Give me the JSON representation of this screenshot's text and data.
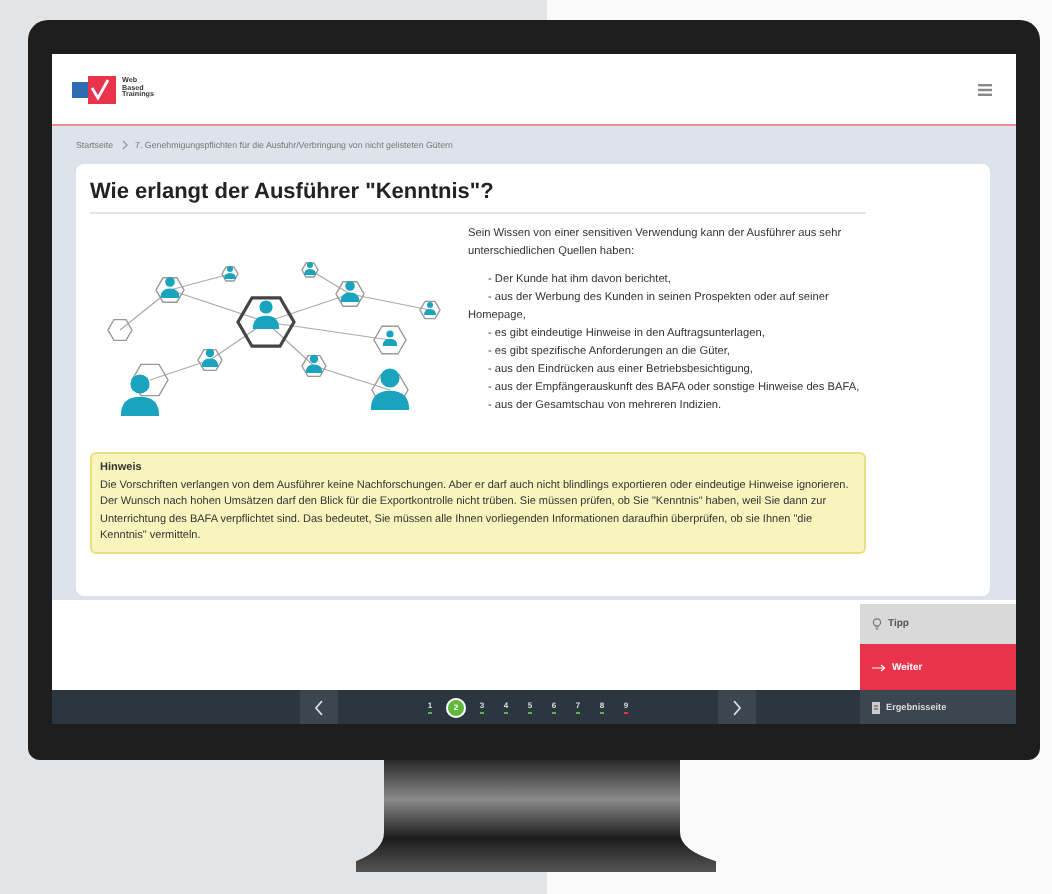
{
  "header": {
    "logo_lines": [
      "Web",
      "Based",
      "Trainings"
    ]
  },
  "breadcrumb": [
    "Startseite",
    "7. Genehmigungspflichten für die Ausfuhr/Verbringung von nicht gelisteten Gütern"
  ],
  "content": {
    "title": "Wie erlangt der Ausführer \"Kenntnis\"?",
    "intro": "Sein Wissen von einer sensitiven Verwendung kann der Ausführer aus sehr unterschiedlichen Quellen haben:",
    "bullets": [
      "- Der Kunde hat ihm davon berichtet,",
      "- aus der Werbung des Kunden in seinen Prospekten oder auf seiner Homepage,",
      "- es gibt eindeutige Hinweise in den Auftragsunterlagen,",
      "- es gibt spezifische Anforderungen an die Güter,",
      "- aus den Eindrücken aus einer Betriebsbesichtigung,",
      "- aus der Empfängerauskunft des BAFA oder sonstige Hinweise des BAFA,",
      "- aus der Gesamtschau von mehreren Indizien."
    ],
    "note": {
      "title": "Hinweis",
      "text": "Die Vorschriften verlangen von dem Ausführer keine Nachforschungen. Aber er darf auch nicht blindlings exportieren oder eindeutige Hinweise ignorieren. Der Wunsch nach hohen Umsätzen darf den Blick für die Exportkontrolle nicht trüben. Sie müssen prüfen, ob Sie \"Kenntnis\" haben, weil Sie dann zur Unterrichtung des BAFA verpflichtet sind. Das bedeutet, Sie müssen alle Ihnen vorliegenden Informationen daraufhin überprüfen, ob sie Ihnen \"die Kenntnis\" vermitteln."
    }
  },
  "side_buttons": [
    {
      "kind": "tip",
      "label": "Tipp"
    },
    {
      "kind": "next",
      "label": "Weiter"
    }
  ],
  "pager": [
    {
      "label": "1",
      "selected": false,
      "color": "#5fb83a"
    },
    {
      "label": "2",
      "selected": true,
      "color": "#5fb83a"
    },
    {
      "label": "3",
      "selected": false,
      "color": "#5fb83a"
    },
    {
      "label": "4",
      "selected": false,
      "color": "#5fb83a"
    },
    {
      "label": "5",
      "selected": false,
      "color": "#5fb83a"
    },
    {
      "label": "6",
      "selected": false,
      "color": "#5fb83a"
    },
    {
      "label": "7",
      "selected": false,
      "color": "#5fb83a"
    },
    {
      "label": "8",
      "selected": false,
      "color": "#5fb83a"
    },
    {
      "label": "9",
      "selected": false,
      "color": "#e8334a"
    }
  ],
  "results_button": "Ergebnisseite"
}
